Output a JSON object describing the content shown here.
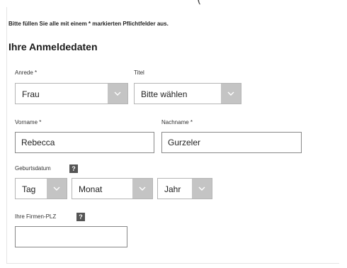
{
  "top_partial_text": "(",
  "form": {
    "notice": "Bitte füllen Sie alle mit einem * markierten Pflichtfelder aus.",
    "section_title": "Ihre Anmeldedaten",
    "anrede": {
      "label": "Anrede *",
      "value": "Frau"
    },
    "titel": {
      "label": "Titel",
      "value": "Bitte wählen"
    },
    "vorname": {
      "label": "Vorname *",
      "value": "Rebecca"
    },
    "nachname": {
      "label": "Nachname *",
      "value": "Gurzeler"
    },
    "geburtsdatum": {
      "label": "Geburtsdatum",
      "help": "?",
      "tag": "Tag",
      "monat": "Monat",
      "jahr": "Jahr"
    },
    "firmen_plz": {
      "label": "Ihre Firmen-PLZ",
      "help": "?",
      "value": ""
    }
  },
  "colors": {
    "chevron_bg": "#c4c4c4",
    "help_icon_bg": "#555555"
  }
}
